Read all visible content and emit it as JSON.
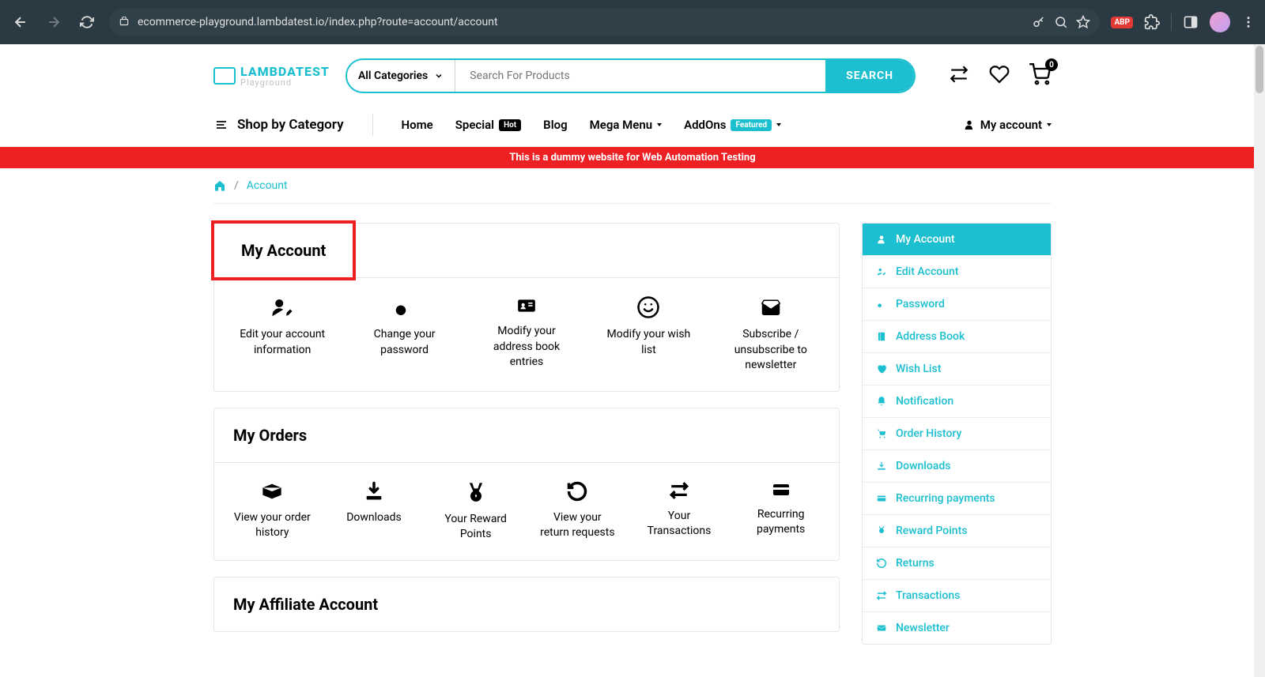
{
  "browser": {
    "url": "ecommerce-playground.lambdatest.io/index.php?route=account/account",
    "abp": "ABP"
  },
  "logo": {
    "name": "LAMBDATEST",
    "sub": "Playground"
  },
  "search": {
    "category": "All Categories",
    "placeholder": "Search For Products",
    "button": "SEARCH"
  },
  "cart_count": "0",
  "nav": {
    "shop_by_category": "Shop by Category",
    "home": "Home",
    "special": "Special",
    "hot": "Hot",
    "blog": "Blog",
    "mega": "Mega Menu",
    "addons": "AddOns",
    "featured": "Featured",
    "my_account": "My account"
  },
  "banner": "This is a dummy website for Web Automation Testing",
  "breadcrumb": "Account",
  "sections": {
    "my_account": {
      "title": "My Account",
      "tiles": [
        "Edit your account information",
        "Change your password",
        "Modify your address book entries",
        "Modify your wish list",
        "Subscribe / unsubscribe to newsletter"
      ]
    },
    "my_orders": {
      "title": "My Orders",
      "tiles": [
        "View your order history",
        "Downloads",
        "Your Reward Points",
        "View your return requests",
        "Your Transactions",
        "Recurring payments"
      ]
    },
    "affiliate": {
      "title": "My Affiliate Account"
    }
  },
  "sidebar": [
    "My Account",
    "Edit Account",
    "Password",
    "Address Book",
    "Wish List",
    "Notification",
    "Order History",
    "Downloads",
    "Recurring payments",
    "Reward Points",
    "Returns",
    "Transactions",
    "Newsletter"
  ]
}
